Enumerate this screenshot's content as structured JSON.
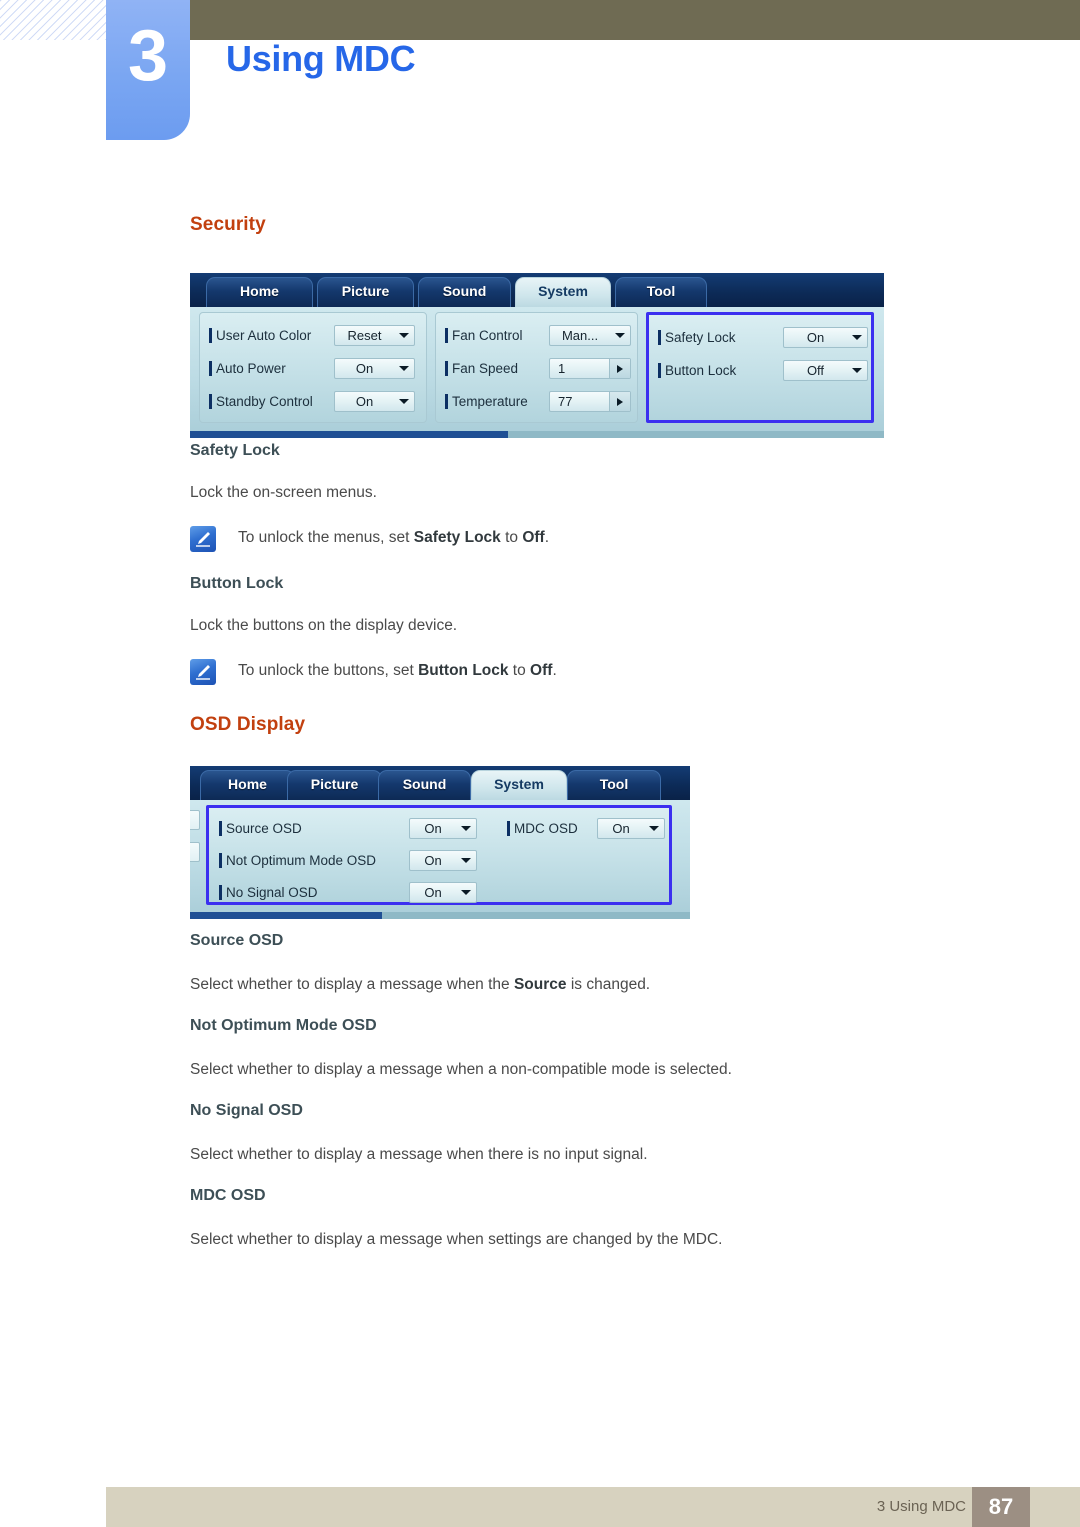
{
  "chapter": {
    "number": "3",
    "title": "Using MDC"
  },
  "sections": [
    {
      "heading": "Security",
      "screenshot": {
        "tabs": [
          {
            "label": "Home",
            "active": false
          },
          {
            "label": "Picture",
            "active": false
          },
          {
            "label": "Sound",
            "active": false
          },
          {
            "label": "System",
            "active": true
          },
          {
            "label": "Tool",
            "active": false
          }
        ],
        "groups": [
          {
            "highlight": false,
            "rows": [
              {
                "label": "User Auto Color",
                "value": "Reset",
                "control": "dropdown"
              },
              {
                "label": "Auto Power",
                "value": "On",
                "control": "dropdown"
              },
              {
                "label": "Standby Control",
                "value": "On",
                "control": "dropdown"
              }
            ]
          },
          {
            "highlight": false,
            "rows": [
              {
                "label": "Fan Control",
                "value": "Man...",
                "control": "dropdown"
              },
              {
                "label": "Fan Speed",
                "value": "1",
                "control": "spinner"
              },
              {
                "label": "Temperature",
                "value": "77",
                "control": "spinner"
              }
            ]
          },
          {
            "highlight": true,
            "rows": [
              {
                "label": "Safety Lock",
                "value": "On",
                "control": "dropdown"
              },
              {
                "label": "Button Lock",
                "value": "Off",
                "control": "dropdown"
              }
            ]
          }
        ]
      },
      "items": [
        {
          "title": "Safety Lock",
          "body": "Lock the on-screen menus.",
          "note": {
            "prefix": "To unlock the menus, set ",
            "bold1": "Safety Lock",
            "middle": " to ",
            "bold2": "Off",
            "suffix": "."
          }
        },
        {
          "title": "Button Lock",
          "body": "Lock the buttons on the display device.",
          "note": {
            "prefix": "To unlock the buttons, set ",
            "bold1": "Button Lock",
            "middle": " to ",
            "bold2": "Off",
            "suffix": "."
          }
        }
      ]
    },
    {
      "heading": "OSD Display",
      "screenshot": {
        "tabs": [
          {
            "label": "Home",
            "active": false
          },
          {
            "label": "Picture",
            "active": false
          },
          {
            "label": "Sound",
            "active": false
          },
          {
            "label": "System",
            "active": true
          },
          {
            "label": "Tool",
            "active": false
          }
        ],
        "rows_left": [
          {
            "label": "Source OSD",
            "value": "On",
            "control": "dropdown"
          },
          {
            "label": "Not Optimum Mode OSD",
            "value": "On",
            "control": "dropdown"
          },
          {
            "label": "No Signal OSD",
            "value": "On",
            "control": "dropdown"
          }
        ],
        "rows_right": [
          {
            "label": "MDC OSD",
            "value": "On",
            "control": "dropdown"
          }
        ]
      },
      "items": [
        {
          "title": "Source OSD",
          "body_prefix": "Select whether to display a message when the ",
          "body_bold": "Source",
          "body_suffix": " is changed."
        },
        {
          "title": "Not Optimum Mode OSD",
          "body": "Select whether to display a message when a non-compatible mode is selected."
        },
        {
          "title": "No Signal OSD",
          "body": "Select whether to display a message when there is no input signal."
        },
        {
          "title": "MDC OSD",
          "body": "Select whether to display a message when settings are changed by the MDC."
        }
      ]
    }
  ],
  "footer": {
    "label": "3 Using MDC",
    "page": "87"
  },
  "colors": {
    "heading": "#c2400f",
    "chapter_title": "#2667e8",
    "chapter_block": "#7aa6f2",
    "olive": "#6f6b53",
    "footer_bar": "#d7d2bf",
    "page_box": "#9c8f83",
    "highlight_border": "#3b2ff0"
  }
}
